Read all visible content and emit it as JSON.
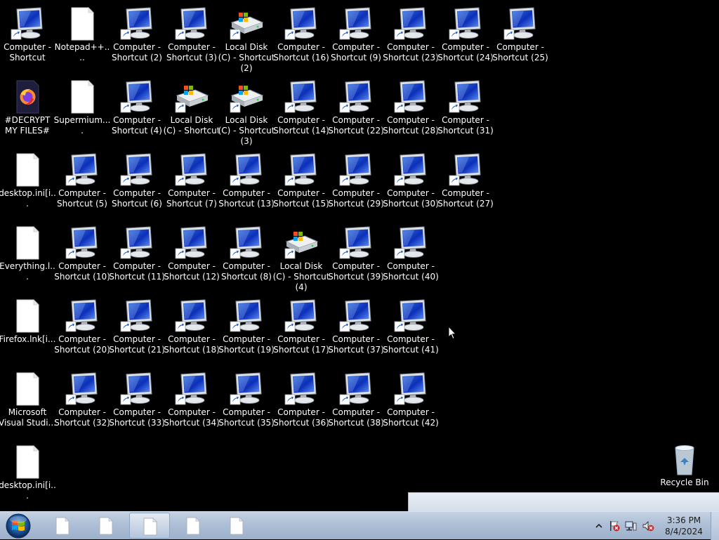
{
  "desktop": {
    "columns": [
      [
        {
          "label": "Computer - Shortcut",
          "icon": "computer-shortcut-icon"
        },
        {
          "label": "#DECRYPT MY FILES#",
          "icon": "firefox-document-icon"
        },
        {
          "label": "desktop.ini[i...",
          "icon": "blank-file-icon"
        },
        {
          "label": "Everything.l...",
          "icon": "blank-file-icon"
        },
        {
          "label": "Firefox.lnk[i...",
          "icon": "blank-file-icon"
        },
        {
          "label": "Microsoft Visual Studi...",
          "icon": "blank-file-icon"
        },
        {
          "label": "desktop.ini[i...",
          "icon": "blank-file-icon"
        }
      ],
      [
        {
          "label": "Notepad++....",
          "icon": "blank-file-icon"
        },
        {
          "label": "Supermium....",
          "icon": "blank-file-icon"
        },
        {
          "label": "Computer - Shortcut (5)",
          "icon": "computer-shortcut-icon"
        },
        {
          "label": "Computer - Shortcut (10)",
          "icon": "computer-shortcut-icon"
        },
        {
          "label": "Computer - Shortcut (20)",
          "icon": "computer-shortcut-icon"
        },
        {
          "label": "Computer - Shortcut (32)",
          "icon": "computer-shortcut-icon"
        }
      ],
      [
        {
          "label": "Computer - Shortcut (2)",
          "icon": "computer-shortcut-icon"
        },
        {
          "label": "Computer - Shortcut (4)",
          "icon": "computer-shortcut-icon"
        },
        {
          "label": "Computer - Shortcut (6)",
          "icon": "computer-shortcut-icon"
        },
        {
          "label": "Computer - Shortcut (11)",
          "icon": "computer-shortcut-icon"
        },
        {
          "label": "Computer - Shortcut (21)",
          "icon": "computer-shortcut-icon"
        },
        {
          "label": "Computer - Shortcut (33)",
          "icon": "computer-shortcut-icon"
        }
      ],
      [
        {
          "label": "Computer - Shortcut (3)",
          "icon": "computer-shortcut-icon"
        },
        {
          "label": "Local Disk (C) - Shortcut",
          "icon": "local-disk-shortcut-icon"
        },
        {
          "label": "Computer - Shortcut (7)",
          "icon": "computer-shortcut-icon"
        },
        {
          "label": "Computer - Shortcut (12)",
          "icon": "computer-shortcut-icon"
        },
        {
          "label": "Computer - Shortcut (18)",
          "icon": "computer-shortcut-icon"
        },
        {
          "label": "Computer - Shortcut (34)",
          "icon": "computer-shortcut-icon"
        }
      ],
      [
        {
          "label": "Local Disk (C) - Shortcut (2)",
          "icon": "local-disk-shortcut-icon"
        },
        {
          "label": "Local Disk (C) - Shortcut (3)",
          "icon": "local-disk-shortcut-icon"
        },
        {
          "label": "Computer - Shortcut (13)",
          "icon": "computer-shortcut-icon"
        },
        {
          "label": "Computer - Shortcut (8)",
          "icon": "computer-shortcut-icon"
        },
        {
          "label": "Computer - Shortcut (19)",
          "icon": "computer-shortcut-icon"
        },
        {
          "label": "Computer - Shortcut (35)",
          "icon": "computer-shortcut-icon"
        }
      ],
      [
        {
          "label": "Computer - Shortcut (16)",
          "icon": "computer-shortcut-icon"
        },
        {
          "label": "Computer - Shortcut (14)",
          "icon": "computer-shortcut-icon"
        },
        {
          "label": "Computer - Shortcut (15)",
          "icon": "computer-shortcut-icon"
        },
        {
          "label": "Local Disk (C) - Shortcut (4)",
          "icon": "local-disk-shortcut-icon"
        },
        {
          "label": "Computer - Shortcut (17)",
          "icon": "computer-shortcut-icon"
        },
        {
          "label": "Computer - Shortcut (36)",
          "icon": "computer-shortcut-icon"
        }
      ],
      [
        {
          "label": "Computer - Shortcut (9)",
          "icon": "computer-shortcut-icon"
        },
        {
          "label": "Computer - Shortcut (22)",
          "icon": "computer-shortcut-icon"
        },
        {
          "label": "Computer - Shortcut (29)",
          "icon": "computer-shortcut-icon"
        },
        {
          "label": "Computer - Shortcut (39)",
          "icon": "computer-shortcut-icon"
        },
        {
          "label": "Computer - Shortcut (37)",
          "icon": "computer-shortcut-icon"
        },
        {
          "label": "Computer - Shortcut (38)",
          "icon": "computer-shortcut-icon"
        }
      ],
      [
        {
          "label": "Computer - Shortcut (23)",
          "icon": "computer-shortcut-icon"
        },
        {
          "label": "Computer - Shortcut (28)",
          "icon": "computer-shortcut-icon"
        },
        {
          "label": "Computer - Shortcut (30)",
          "icon": "computer-shortcut-icon"
        },
        {
          "label": "Computer - Shortcut (40)",
          "icon": "computer-shortcut-icon"
        },
        {
          "label": "Computer - Shortcut (41)",
          "icon": "computer-shortcut-icon"
        },
        {
          "label": "Computer - Shortcut (42)",
          "icon": "computer-shortcut-icon"
        }
      ],
      [
        {
          "label": "Computer - Shortcut (24)",
          "icon": "computer-shortcut-icon"
        },
        {
          "label": "Computer - Shortcut (31)",
          "icon": "computer-shortcut-icon"
        },
        {
          "label": "Computer - Shortcut (27)",
          "icon": "computer-shortcut-icon"
        }
      ],
      [
        {
          "label": "Computer - Shortcut (25)",
          "icon": "computer-shortcut-icon"
        }
      ]
    ],
    "recycle_bin": {
      "label": "Recycle Bin",
      "icon": "recycle-bin-icon"
    }
  },
  "taskbar": {
    "start_icon": "windows-start-orb-icon",
    "buttons": [
      {
        "icon": "document-icon",
        "active": false
      },
      {
        "icon": "document-icon",
        "active": false
      },
      {
        "icon": "document-icon",
        "active": true
      },
      {
        "icon": "document-icon",
        "active": false
      },
      {
        "icon": "document-icon",
        "active": false
      }
    ],
    "tray": {
      "icons": [
        "show-hidden-icons-chevron-icon",
        "action-center-flag-error-icon",
        "network-error-icon",
        "volume-muted-icon"
      ],
      "time": "3:36 PM",
      "date": "8/4/2024"
    }
  },
  "colors": {
    "desktop_background": "#000000",
    "taskbar": "#aebfd6",
    "label_text": "#ffffff"
  }
}
